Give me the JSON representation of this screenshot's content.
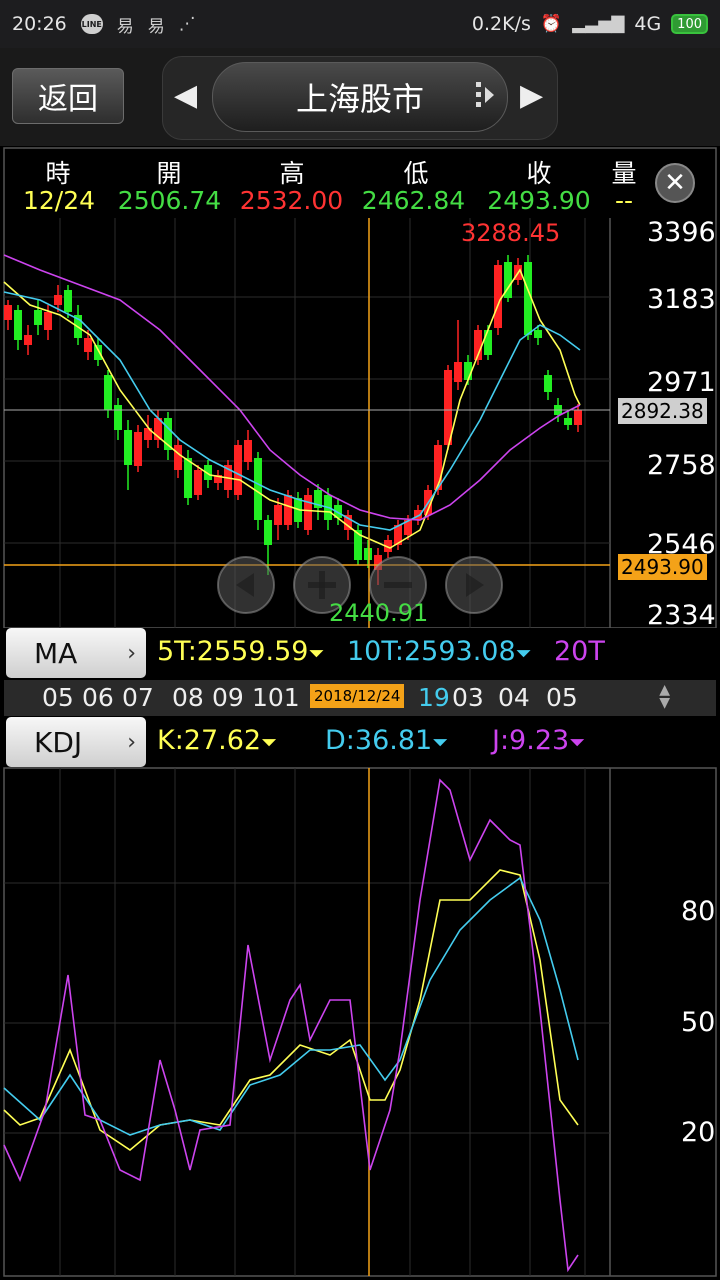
{
  "status_bar": {
    "time": "20:26",
    "net_speed": "0.2K/s",
    "network": "4G",
    "battery": "100",
    "icons": [
      "line-icon",
      "app-icon",
      "app-icon",
      "signal-dots-icon",
      "alarm-icon",
      "signal-icon"
    ]
  },
  "header": {
    "back_label": "返回",
    "title": "上海股市",
    "prev_icon": "triangle-left-icon",
    "next_icon": "triangle-right-icon",
    "menu_icon": "grip-icon"
  },
  "info_panel": {
    "labels": [
      "時",
      "開",
      "高",
      "低",
      "收",
      "量"
    ],
    "values": [
      "12/24",
      "2506.74",
      "2532.00",
      "2462.84",
      "2493.90",
      "--"
    ],
    "colors": [
      "#ffff55",
      "#44dd44",
      "#ff3333",
      "#44dd44",
      "#44dd44",
      "#ffff55"
    ]
  },
  "price_chart": {
    "y_ticks": [
      "3396",
      "3183",
      "2971",
      "2758",
      "2546",
      "2334"
    ],
    "high_label": "3288.45",
    "low_label": "2440.91",
    "crosshair_price": "2892.38",
    "last_price": "2493.90",
    "zoom_controls": [
      "prev-icon",
      "zoom-in-icon",
      "zoom-out-icon",
      "next-icon"
    ]
  },
  "ma_row": {
    "button": "MA",
    "ma5": "5T:2559.59",
    "ma10": "10T:2593.08",
    "ma20": "20T"
  },
  "date_strip": {
    "dates": [
      "05",
      "06",
      "07",
      "08",
      "09",
      "101",
      "19",
      "03",
      "04",
      "05"
    ],
    "selected": "2018/12/24"
  },
  "kdj_row": {
    "button": "KDJ",
    "k": "K:27.62",
    "d": "D:36.81",
    "j": "J:9.23"
  },
  "kdj_chart": {
    "y_ticks": [
      "80",
      "50",
      "20"
    ]
  },
  "colors": {
    "up": "#ff2222",
    "down": "#22ee22",
    "ma5": "#ffff55",
    "ma10": "#44ccee",
    "ma20": "#cc44ee",
    "crosshair": "#f4a218"
  }
}
